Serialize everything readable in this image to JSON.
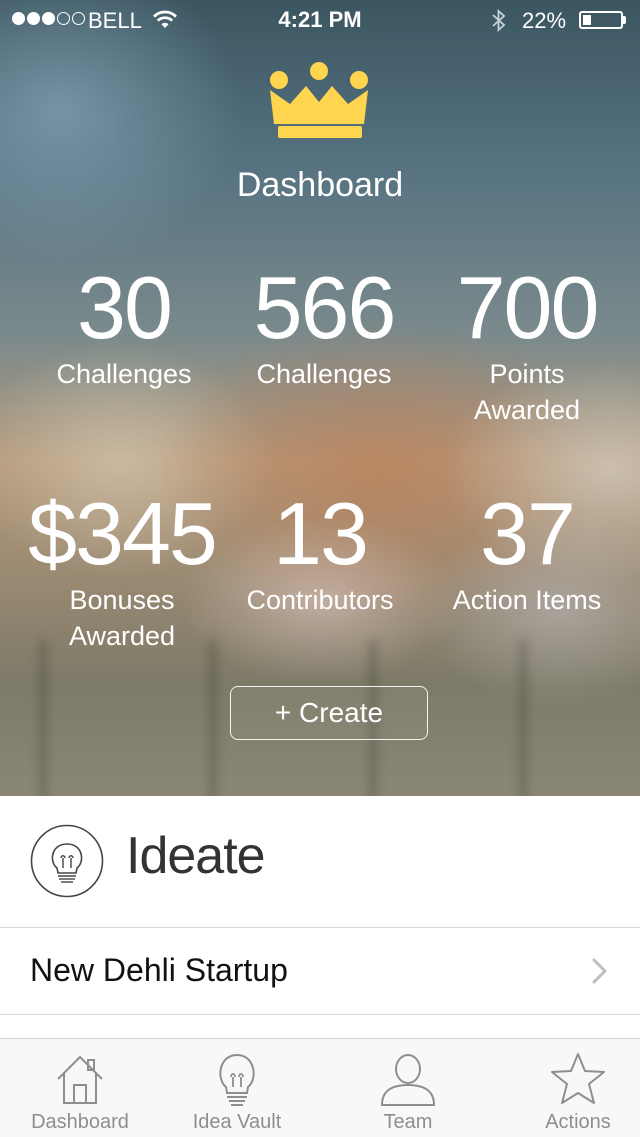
{
  "status_bar": {
    "carrier": "BELL",
    "time": "4:21 PM",
    "battery_percent": "22%",
    "battery_level": 0.22,
    "signal_bars_filled": 3,
    "signal_bars_total": 5
  },
  "header": {
    "title": "Dashboard",
    "icon": "crown-icon",
    "accent_color": "#FFD44F"
  },
  "stats": [
    {
      "value": "30",
      "label": "Challenges"
    },
    {
      "value": "566",
      "label": "Challenges"
    },
    {
      "value": "700",
      "label": "Points Awarded"
    },
    {
      "value": "$345",
      "label": "Bonuses Awarded"
    },
    {
      "value": "13",
      "label": "Contributors"
    },
    {
      "value": "37",
      "label": "Action Items"
    }
  ],
  "create_button": {
    "label": "+ Create"
  },
  "section": {
    "title": "Ideate",
    "icon": "lightbulb-icon"
  },
  "list": {
    "items": [
      {
        "label": "New Dehli Startup",
        "icon": "chevron-right-icon"
      }
    ]
  },
  "tabbar": {
    "items": [
      {
        "label": "Dashboard",
        "icon": "house-icon"
      },
      {
        "label": "Idea Vault",
        "icon": "lightbulb-icon"
      },
      {
        "label": "Team",
        "icon": "person-icon"
      },
      {
        "label": "Actions",
        "icon": "star-icon"
      }
    ]
  }
}
